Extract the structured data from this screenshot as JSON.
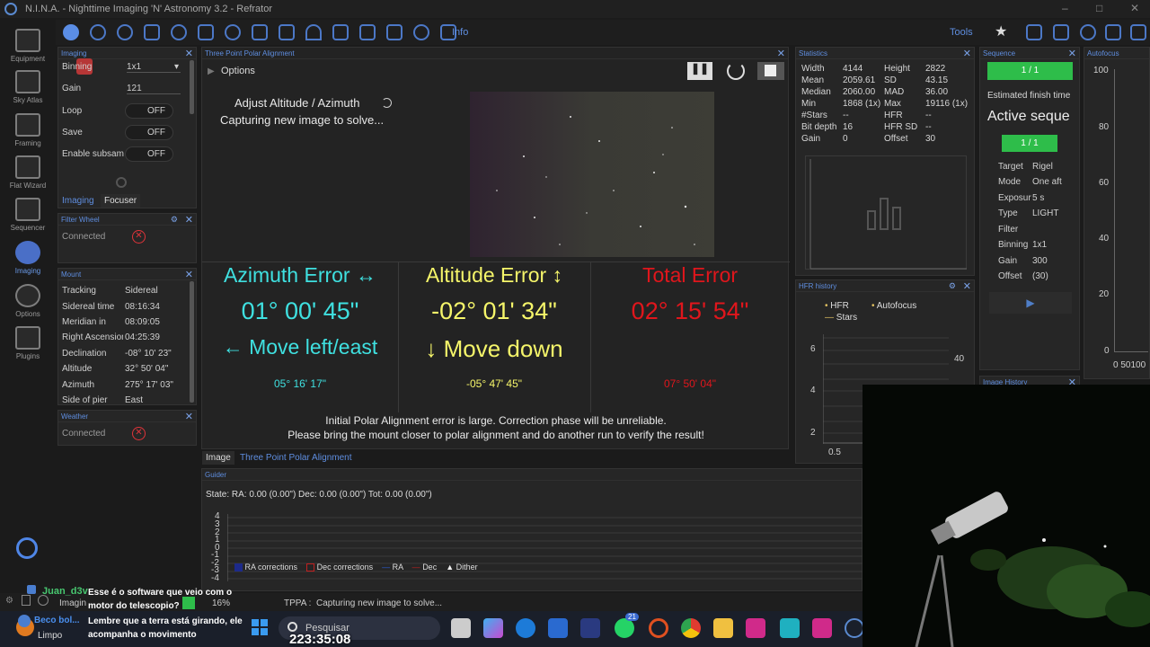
{
  "app": {
    "title": "N.I.N.A. - Nighttime Imaging 'N' Astronomy 3.2  -  Refrator"
  },
  "nav": [
    {
      "label": "Equipment",
      "icon": "telescope-icon"
    },
    {
      "label": "Sky Atlas",
      "icon": "sky-atlas-icon"
    },
    {
      "label": "Framing",
      "icon": "framing-icon"
    },
    {
      "label": "Flat Wizard",
      "icon": "flat-wizard-icon"
    },
    {
      "label": "Sequencer",
      "icon": "sequencer-icon"
    },
    {
      "label": "Imaging",
      "icon": "imaging-icon"
    },
    {
      "label": "Options",
      "icon": "gear-icon"
    },
    {
      "label": "Plugins",
      "icon": "puzzle-icon"
    }
  ],
  "toolbar": {
    "info_label": "Info",
    "tools_label": "Tools"
  },
  "imaging_panel": {
    "title": "Imaging",
    "binning_label": "Binning",
    "binning_value": "1x1",
    "gain_label": "Gain",
    "gain_value": "121",
    "loop_label": "Loop",
    "loop_value": "OFF",
    "save_label": "Save",
    "save_value": "OFF",
    "subsam_label": "Enable subsam",
    "subsam_value": "OFF",
    "tab_imaging": "Imaging",
    "tab_focuser": "Focuser"
  },
  "filter_wheel": {
    "title": "Filter Wheel",
    "status": "Connected"
  },
  "mount": {
    "title": "Mount",
    "rows": [
      {
        "label": "Tracking",
        "value": "Sidereal"
      },
      {
        "label": "Sidereal time",
        "value": "08:16:34"
      },
      {
        "label": "Meridian in",
        "value": "08:09:05"
      },
      {
        "label": "Right Ascension",
        "value": "04:25:39"
      },
      {
        "label": "Declination",
        "value": "-08° 10' 23\""
      },
      {
        "label": "Altitude",
        "value": "32° 50' 04\""
      },
      {
        "label": "Azimuth",
        "value": "275° 17' 03\""
      },
      {
        "label": "Side of pier",
        "value": "East"
      }
    ]
  },
  "weather": {
    "title": "Weather",
    "status": "Connected"
  },
  "tppa": {
    "title": "Three Point Polar Alignment",
    "options_label": "Options",
    "step_label": "Adjust Altitude / Azimuth",
    "status_text": "Capturing new image to solve...",
    "azimuth": {
      "heading": "Azimuth Error ↔",
      "value": "01° 00' 45\"",
      "direction": "← Move left/east",
      "sub": "05° 16' 17\""
    },
    "altitude": {
      "heading": "Altitude Error ↕",
      "value": "-02° 01' 34\"",
      "direction": "↓ Move down",
      "sub": "-05° 47' 45\""
    },
    "total": {
      "heading": "Total Error",
      "value": "02° 15' 54\"",
      "sub": "07° 50' 04\""
    },
    "warning_line1": "Initial Polar Alignment error is large. Correction phase will be unreliable.",
    "warning_line2": "Please bring the mount closer to polar alignment and do another run to verify the result!",
    "tab_image": "Image",
    "tab_tppa": "Three Point Polar Alignment"
  },
  "statistics": {
    "title": "Statistics",
    "rows": [
      {
        "l1": "Width",
        "v1": "4144",
        "l2": "Height",
        "v2": "2822"
      },
      {
        "l1": "Mean",
        "v1": "2059.61",
        "l2": "SD",
        "v2": "43.15"
      },
      {
        "l1": "Median",
        "v1": "2060.00",
        "l2": "MAD",
        "v2": "36.00"
      },
      {
        "l1": "Min",
        "v1": "1868 (1x)",
        "l2": "Max",
        "v2": "19116 (1x)"
      },
      {
        "l1": "#Stars",
        "v1": "--",
        "l2": "HFR",
        "v2": "--"
      },
      {
        "l1": "Bit depth",
        "v1": "16",
        "l2": "HFR SD",
        "v2": "--"
      },
      {
        "l1": "Gain",
        "v1": "0",
        "l2": "Offset",
        "v2": "30"
      }
    ]
  },
  "hfr_history": {
    "title": "HFR history",
    "legend_hfr": "HFR",
    "legend_autofocus": "Autofocus",
    "legend_stars": "Stars",
    "y_ticks": [
      "6",
      "4",
      "2"
    ],
    "right_tick": "40",
    "x_tick": "0.5"
  },
  "sequence": {
    "title": "Sequence",
    "progress1": "1 / 1",
    "finish_label": "Estimated finish time",
    "active_label": "Active seque",
    "progress2": "1 / 1",
    "rows": [
      {
        "label": "Target",
        "value": "Rigel"
      },
      {
        "label": "Mode",
        "value": "One aft"
      },
      {
        "label": "Exposur",
        "value": "5 s"
      },
      {
        "label": "Type",
        "value": "LIGHT"
      },
      {
        "label": "Filter",
        "value": ""
      },
      {
        "label": "Binning",
        "value": "1x1"
      },
      {
        "label": "Gain",
        "value": "300"
      },
      {
        "label": "Offset",
        "value": "(30)"
      }
    ]
  },
  "image_history": {
    "title": "Image History"
  },
  "autofocus": {
    "title": "Autofocus",
    "y_ticks": [
      "100",
      "80",
      "60",
      "40",
      "20",
      "0"
    ],
    "x_tick": "0 50100"
  },
  "guider": {
    "title": "Guider",
    "state_text": "State:  RA: 0.00 (0.00\")  Dec: 0.00 (0.00\")  Tot: 0.00 (0.00\")",
    "y_ticks": [
      "4",
      "3",
      "2",
      "1",
      "0",
      "-1",
      "-2",
      "-3",
      "-4"
    ],
    "legend": [
      "RA corrections",
      "Dec corrections",
      "RA",
      "Dec",
      "Dither"
    ]
  },
  "statusbar": {
    "tppa_label": "TPPA :",
    "tppa_status": "Capturing new image to solve...",
    "percent": "16%",
    "imaging_label": "Imagin"
  },
  "chat": [
    {
      "user": "Juan_d3v",
      "text": "Esse é o software que veio com o motor do telescopio?"
    },
    {
      "user": "Beco bol...",
      "text": "Lembre que a terra está girando, ele acompanha o movimento"
    }
  ],
  "taskbar": {
    "search_placeholder": "Pesquisar",
    "weather_label": "Limpo",
    "clock": "223:35:08",
    "whatsapp_badge": "21"
  }
}
